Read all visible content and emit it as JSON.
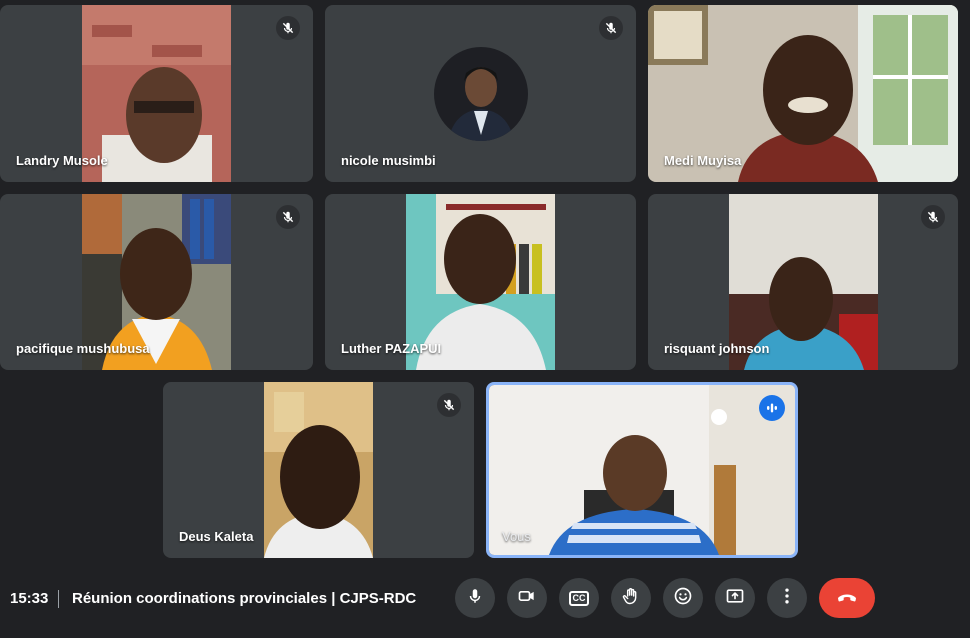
{
  "meeting": {
    "time": "15:33",
    "title": "Réunion coordinations provinciales | CJPS-RDC"
  },
  "participants": [
    {
      "name": "Landry Musole",
      "muted": true
    },
    {
      "name": "nicole musimbi",
      "muted": true
    },
    {
      "name": "Medi Muyisa",
      "muted": false
    },
    {
      "name": "pacifique mushubusa",
      "muted": true
    },
    {
      "name": "Luther PAZAPUI",
      "muted": false
    },
    {
      "name": "risquant johnson",
      "muted": true
    },
    {
      "name": "Deus Kaleta",
      "muted": true
    },
    {
      "name": "Vous",
      "muted": false,
      "speaking": true
    }
  ],
  "controls": {
    "icons": [
      "mic-icon",
      "camera-icon",
      "captions-icon",
      "raise-hand-icon",
      "emoji-icon",
      "present-screen-icon",
      "more-options-icon",
      "hang-up-icon"
    ],
    "captions_label": "CC"
  },
  "colors": {
    "background": "#202124",
    "tile": "#3c4043",
    "accent": "#8ab4f8",
    "speaking": "#1a73e8",
    "hangup": "#ea4335"
  }
}
